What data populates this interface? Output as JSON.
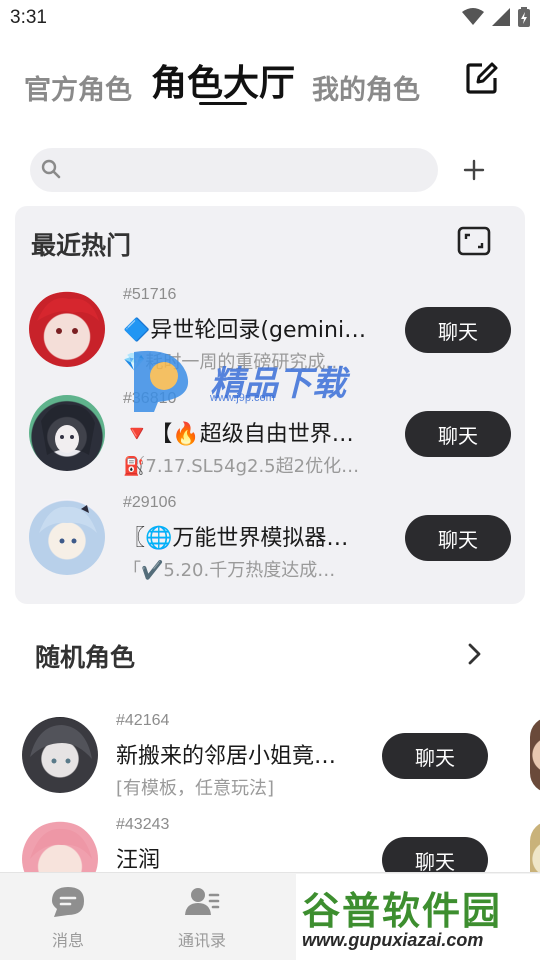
{
  "status_bar": {
    "time": "3:31"
  },
  "tabs": [
    {
      "label": "官方角色"
    },
    {
      "label": "角色大厅"
    },
    {
      "label": "我的角色"
    }
  ],
  "search": {
    "placeholder": "",
    "value": ""
  },
  "hot": {
    "title": "最近热门",
    "items": [
      {
        "id": "#51716",
        "name": "🔷异世轮回录(gemini…",
        "desc": "💎耗时一周的重磅研究成…",
        "button": "聊天"
      },
      {
        "id": "#36810",
        "name": "🔻【🔥超级自由世界…",
        "desc": "⛽7.17.SL54g2.5超2优化…",
        "button": "聊天"
      },
      {
        "id": "#29106",
        "name": "〖🌐万能世界模拟器…",
        "desc": "「✔️5.20.千万热度达成…",
        "button": "聊天"
      }
    ]
  },
  "random": {
    "title": "随机角色",
    "items": [
      {
        "id": "#42164",
        "name": "新搬来的邻居小姐竟…",
        "desc": "[有模板，任意玩法]",
        "button": "聊天"
      },
      {
        "id": "#43243",
        "name": "汪润",
        "desc": "",
        "button": "聊天"
      }
    ]
  },
  "bottom_nav": [
    {
      "label": "消息",
      "icon": "message-icon"
    },
    {
      "label": "通讯录",
      "icon": "contacts-icon"
    }
  ],
  "watermarks": {
    "middle": "精品下载",
    "middle_url": "www.j9p.com",
    "corner": "谷普软件园",
    "corner_url": "www.gupuxiazai.com"
  },
  "colors": {
    "chat_button": "#2b2b2e",
    "card_bg": "#f1f1f4",
    "corner_watermark": "#3d8e2f"
  }
}
